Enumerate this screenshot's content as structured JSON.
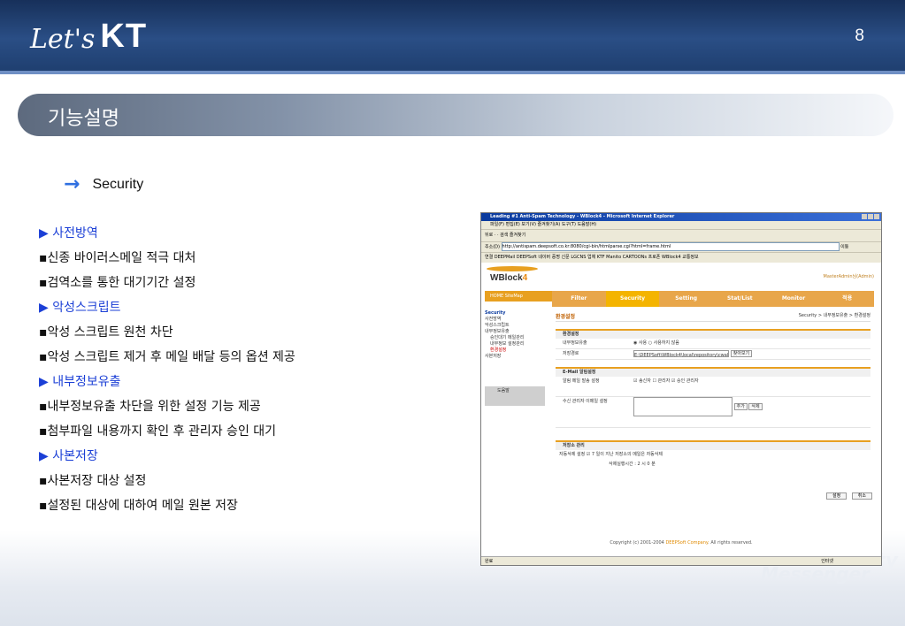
{
  "header": {
    "logo_lets": "Let's",
    "logo_kt": "KT",
    "page_number": "8"
  },
  "section": {
    "title": "기능설명"
  },
  "subtitle": {
    "arrow": "→",
    "text": "Security"
  },
  "items": [
    {
      "kind": "head",
      "text": "▶ 사전방역"
    },
    {
      "kind": "bul",
      "text": "▪신종 바이러스메일 적극 대처"
    },
    {
      "kind": "bul",
      "text": "▪검역소를 통한 대기기간 설정"
    },
    {
      "kind": "head",
      "text": "▶ 악성스크립트"
    },
    {
      "kind": "bul",
      "text": "▪악성 스크립트 원천 차단"
    },
    {
      "kind": "bul",
      "text": "▪악성 스크립트 제거 후 메일 배달 등의 옵션 제공"
    },
    {
      "kind": "head",
      "text": "▶ 내부정보유출"
    },
    {
      "kind": "bul",
      "text": "▪내부정보유출 차단을 위한 설정 기능 제공"
    },
    {
      "kind": "bul",
      "text": "▪첨부파일 내용까지 확인 후 관리자 승인 대기"
    },
    {
      "kind": "head",
      "text": "▶ 사본저장"
    },
    {
      "kind": "bul",
      "text": "▪사본저장 대상 설정"
    },
    {
      "kind": "bul",
      "text": "▪설정된 대상에 대하여 메일 원본 저장"
    }
  ],
  "watermark": {
    "line1": "ity",
    "line2": "Messenger"
  },
  "screenshot": {
    "title": "Leading #1 Anti-Spam Technology - WBlock4 - Microsoft Internet Explorer",
    "menu": "파일(F)  편집(E)  보기(V)  즐겨찾기(A)  도구(T)  도움말(H)",
    "tools": "뒤로 ·  ·  검색  즐겨찾기",
    "address_label": "주소(D)",
    "address": "http://antispam.deepsoft.co.kr:8080/cgi-bin/htmlparse.cgi?html=frame.html",
    "go": "이동",
    "links": "연결  DEEPMail  DEEPSoft  네이버  증명  신문  LGCNS  업체  KTF  Manito  CARTOONs  프로폰  WBlock4  교통정보",
    "logo_w": "WBlock",
    "logo_4": "4",
    "admin": "MasterAdmin님(Admin)",
    "home": "HOME  SiteMap",
    "nav": [
      "Filter",
      "Security",
      "Setting",
      "Stat/List",
      "Monitor",
      "적용"
    ],
    "side": {
      "title": "Security",
      "items": [
        "사전방역",
        "악성스크립트",
        "내부정보유출",
        "승인대기 메일관리",
        "내부정보 설정관리",
        "환경설정",
        "사본저장"
      ],
      "help": "도움말"
    },
    "main_title": "환경설정",
    "crumb": "Security > 내부정보유출 > 환경설정",
    "g1": {
      "head": "환경설정",
      "r1k": "내부정보유출",
      "r1v": "◉ 사용  ○ 사용하지 않음",
      "r2k": "저장경로",
      "r2v": "E:\\DEEPSoft\\WBlock4\\local\\repository\\cwal",
      "r2b": "찾아보기"
    },
    "g2": {
      "head": "E-Mail 알림설정",
      "r1k": "알림 메일 발송 설정",
      "r1v": "☑ 송신자  ☐ 관리자  ☑ 승인 관리자",
      "r2k": "수신 관리자 이메일 설정",
      "b_add": "추가",
      "b_del": "삭제"
    },
    "g3": {
      "head": "저장소 관리",
      "r1": "자동삭제 설정 ☑ 7 일이 지난 저장소의 메일은 자동삭제",
      "r2": "삭제실행시간 : 2 시 0 분"
    },
    "ok": "설정",
    "cancel": "취소",
    "copyright_a": "Copyright (c) 2001-2004 ",
    "copyright_b": "DEEPSoft Company",
    "copyright_c": ". All rights reserved.",
    "status": "완료",
    "zone": "인터넷"
  }
}
